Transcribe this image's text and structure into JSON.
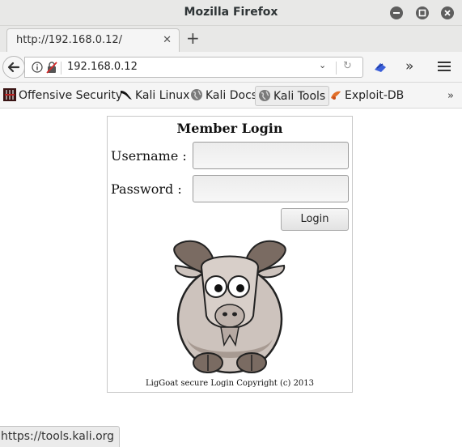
{
  "window": {
    "title": "Mozilla Firefox"
  },
  "tabs": [
    {
      "label": "http://192.168.0.12/"
    }
  ],
  "navbar": {
    "url": "192.168.0.12"
  },
  "bookmarks": [
    {
      "label": "Offensive Security",
      "icon": "offsec-icon"
    },
    {
      "label": "Kali Linux",
      "icon": "kali-dragon-icon"
    },
    {
      "label": "Kali Docs",
      "icon": "globe-icon"
    },
    {
      "label": "Kali Tools",
      "icon": "globe-icon"
    },
    {
      "label": "Exploit-DB",
      "icon": "exploitdb-icon"
    }
  ],
  "login": {
    "title": "Member Login",
    "username_label": "Username :",
    "username_value": "",
    "password_label": "Password  :",
    "password_value": "",
    "button_label": "Login",
    "copyright": "LigGoat secure Login Copyright (c) 2013"
  },
  "status": {
    "text": "https://tools.kali.org"
  },
  "colors": {
    "accent": "#3b5fd9",
    "chrome": "#e8e8e7",
    "bar": "#f5f5f5"
  }
}
